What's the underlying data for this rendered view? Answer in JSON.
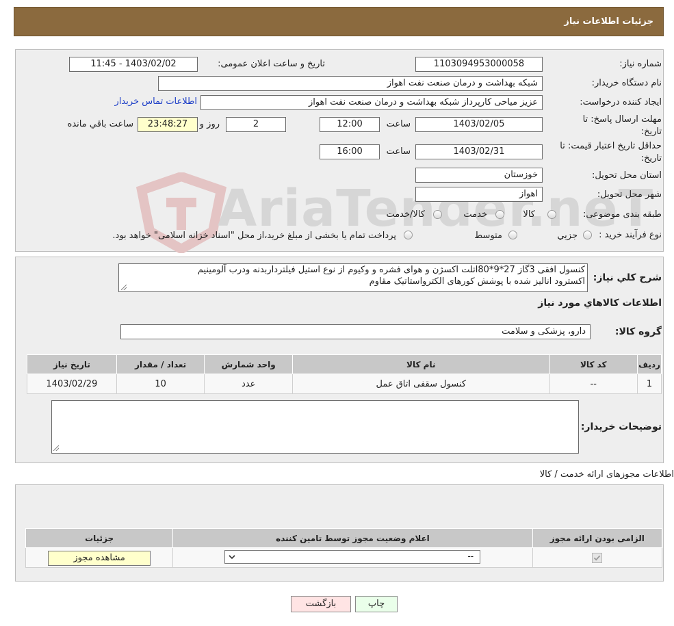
{
  "header": {
    "title": "جزئیات اطلاعات نیاز"
  },
  "info": {
    "need_number_label": "شماره نیاز:",
    "need_number": "1103094953000058",
    "announce_label": "تاریخ و ساعت اعلان عمومی:",
    "announce_value": "1403/02/02 - 11:45",
    "buyer_org_label": "نام دستگاه خریدار:",
    "buyer_org": "شبکه بهداشت و درمان صنعت نفت اهواز",
    "creator_label": "ایجاد کننده درخواست:",
    "creator": "عزیز میاحی کارپرداز شبکه بهداشت و درمان صنعت نفت اهواز",
    "contact_link": "اطلاعات تماس خریدار",
    "deadline_label": "مهلت ارسال پاسخ: تا تاریخ:",
    "deadline_date": "1403/02/05",
    "time_label": "ساعت",
    "deadline_time": "12:00",
    "days_value": "2",
    "days_label": "روز و",
    "remaining_value": "23:48:27",
    "remaining_label": "ساعت باقي مانده",
    "validity_label": "حداقل تاریخ اعتبار قیمت: تا تاریخ:",
    "validity_date": "1403/02/31",
    "validity_time": "16:00",
    "province_label": "استان محل تحویل:",
    "province": "خوزستان",
    "city_label": "شهر محل تحویل:",
    "city": "اهواز",
    "category_label": "طبقه بندی موضوعی:",
    "category_options": [
      "کالا",
      "خدمت",
      "کالا/خدمت"
    ],
    "process_label": "نوع فرآیند خرید :",
    "process_options": [
      "جزيي",
      "متوسط"
    ],
    "process_note": "پرداخت تمام یا بخشی از مبلغ خرید،از محل \"اسناد خزانه اسلامی\" خواهد بود."
  },
  "watermark": "AriaTender.neT",
  "details": {
    "summary_label": "شرح کلي نياز:",
    "summary_line1": "کنسول افقی 3گاز  27*9*80اتلت اکسژن و هوای فشره  و وکیوم از نوع استیل فیلترداربدنه ودرب آلومینیم",
    "summary_line2": "اکسترود انالیز شده با پوشش کورهای الکترواستاتیک مقاوم",
    "goods_info_title": "اطلاعات کالاهاي مورد نياز",
    "goods_group_label": "گروه کالا:",
    "goods_group": "دارو، پزشکی و سلامت",
    "table_headers": [
      "رديف",
      "کد کالا",
      "نام کالا",
      "واحد شمارش",
      "تعداد / مقدار",
      "تاريخ نياز"
    ],
    "table_rows": [
      [
        "1",
        "--",
        "کنسول سقفی اتاق عمل",
        "عدد",
        "10",
        "1403/02/29"
      ]
    ],
    "buyer_notes_label": "توضیحات خریدار:",
    "buyer_notes": ""
  },
  "permits": {
    "title": "اطلاعات مجوزهای ارائه خدمت / کالا",
    "table_headers": [
      "الزامی بودن ارائه مجوز",
      "اعلام وضعیت مجوز توسط تامین کننده",
      "جزئیات"
    ],
    "select_value": "--",
    "view_button": "مشاهده مجوز"
  },
  "footer": {
    "print_button": "چاپ",
    "back_button": "بازگشت"
  }
}
